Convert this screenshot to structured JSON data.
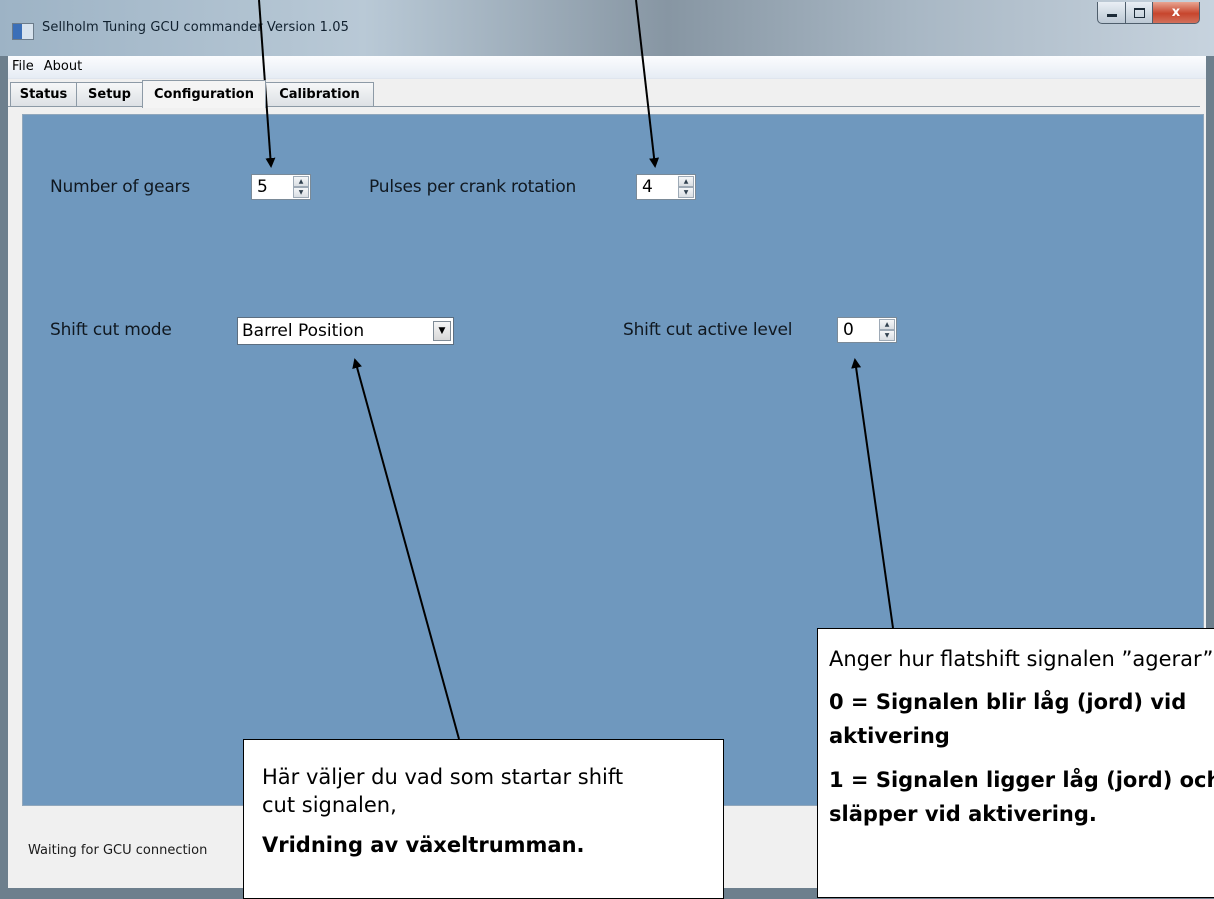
{
  "window": {
    "title": "Sellholm Tuning GCU commander Version 1.05",
    "close_glyph": "x"
  },
  "menu": {
    "items": [
      {
        "label": "File"
      },
      {
        "label": "About"
      }
    ]
  },
  "tabs": [
    {
      "label": "Status",
      "active": false
    },
    {
      "label": "Setup",
      "active": false
    },
    {
      "label": "Configuration",
      "active": true
    },
    {
      "label": "Calibration",
      "active": false
    }
  ],
  "configuration": {
    "gears_label": "Number of gears",
    "gears_value": "5",
    "pulses_label": "Pulses per crank rotation",
    "pulses_value": "4",
    "shift_mode_label": "Shift cut mode",
    "shift_mode_value": "Barrel Position",
    "active_level_label": "Shift cut active level",
    "active_level_value": "0"
  },
  "status": {
    "text": "Waiting for GCU connection"
  },
  "callouts": {
    "left": {
      "line1": "Här väljer du vad som startar shift",
      "line2": "cut signalen,",
      "bold": "Vridning av växeltrumman."
    },
    "right": {
      "intro": "Anger hur flatshift signalen ”agerar”",
      "item0_line1": "0 = Signalen blir låg (jord) vid",
      "item0_line2": "aktivering",
      "item1_line1": "1 = Signalen ligger låg (jord) och",
      "item1_line2": "släpper vid aktivering."
    }
  },
  "icons": {
    "app": "app-icon",
    "minimize": "minimize-icon",
    "maximize": "maximize-icon",
    "close": "close-icon",
    "spin_up": "chevron-up-icon",
    "spin_down": "chevron-down-icon",
    "dropdown": "dropdown-arrow-icon"
  }
}
